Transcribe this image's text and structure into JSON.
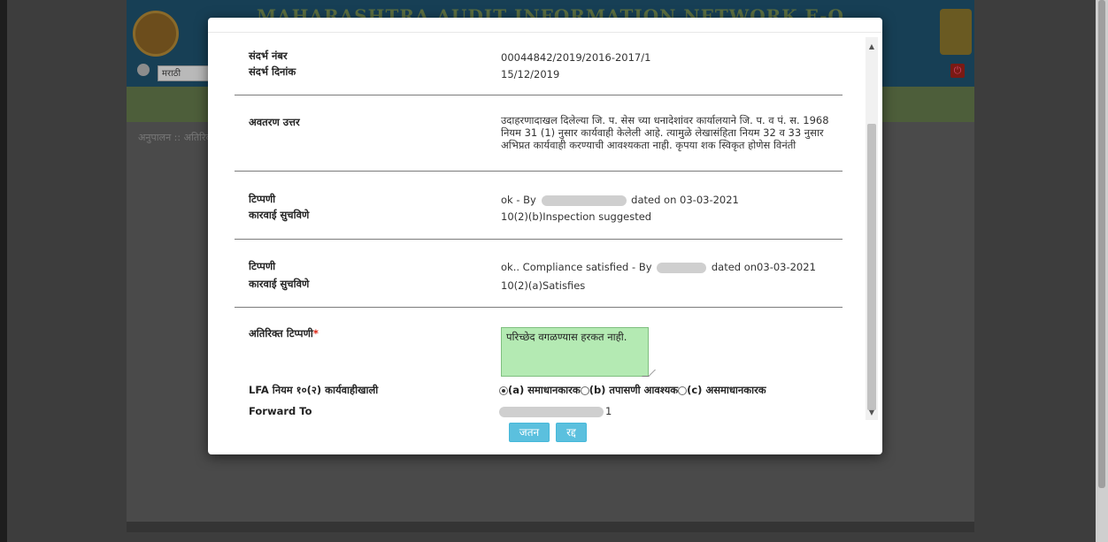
{
  "background_app": {
    "title": "MAHARASHTRA AUDIT INFORMATION NETWORK E-O",
    "language": "मराठी",
    "breadcrumb": "अनुपालन :: अतिरिक्त"
  },
  "modal": {
    "fields": {
      "ref_no_label": "संदर्भ नंबर",
      "ref_no_value": "00044842/2019/2016-2017/1",
      "ref_date_label": "संदर्भ दिनांक",
      "ref_date_value": "15/12/2019",
      "excerpt_reply_label": "अवतरण उत्तर",
      "excerpt_reply_value": "उदाहरणादाखल दिलेल्या जि. प. सेस च्या धनादेशांवर कार्यालयाने जि. प. व पं. स. 1968 नियम 31 (1) नुसार कार्यवाही केलेली आहे. त्यामुळे लेखासंहिता नियम 32 व 33 नुसार अभिप्रत कार्यवाही करण्याची आवश्यकता नाही. कृपया शक स्विकृत होणेस विनंती"
    },
    "comment_1": {
      "remark_label": "टिप्पणी",
      "remark_prefix": "ok - By",
      "remark_suffix": "dated on 03-03-2021",
      "action_label": "कारवाई सुचविणे",
      "action_value": "10(2)(b)Inspection suggested"
    },
    "comment_2": {
      "remark_label": "टिप्पणी",
      "remark_prefix": "ok.. Compliance satisfied - By",
      "remark_suffix": "dated on03-03-2021",
      "action_label": "कारवाई सुचविणे",
      "action_value": "10(2)(a)Satisfies"
    },
    "additional_remark": {
      "label": "अतिरिक्त टिप्पणी",
      "required_mark": "*",
      "value": "परिच्छेद वगळण्यास हरकत नाही."
    },
    "lfa_rule": {
      "label": "LFA नियम १०(२) कार्यवाहीखाली",
      "options": [
        {
          "label": "(a) समाधानकारक",
          "selected": true
        },
        {
          "label": "(b) तपासणी आवश्यक",
          "selected": false
        },
        {
          "label": "(c) असमाधानकारक",
          "selected": false
        }
      ]
    },
    "forward_to": {
      "label": "Forward To",
      "value_suffix": "1"
    },
    "buttons": {
      "save": "जतन",
      "cancel": "रद्द"
    }
  },
  "colors": {
    "button": "#5bc0de",
    "remark_box": "#b4eab3",
    "required": "#dd2211"
  }
}
